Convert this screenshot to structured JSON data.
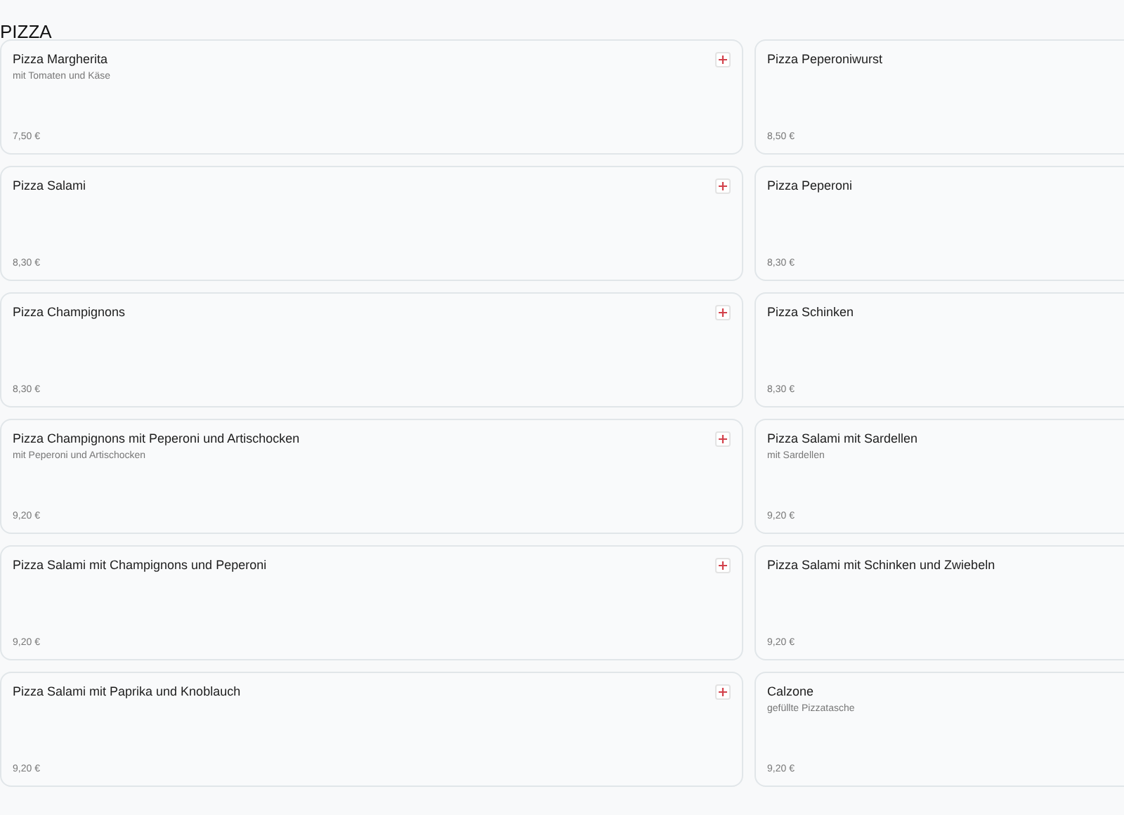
{
  "heading": "PIZZA",
  "items": [
    {
      "name": "Pizza Margherita",
      "description": "mit Tomaten und Käse",
      "price": "7,50 €"
    },
    {
      "name": "Pizza Peperoniwurst",
      "price": "8,50 €"
    },
    {
      "name": "Pizza Salami",
      "price": "8,30 €"
    },
    {
      "name": "Pizza Peperoni",
      "price": "8,30 €"
    },
    {
      "name": "Pizza Champignons",
      "price": "8,30 €"
    },
    {
      "name": "Pizza Schinken",
      "price": "8,30 €"
    },
    {
      "name": "Pizza Champignons mit Peperoni und Artischocken",
      "description": "mit Peperoni und Artischocken",
      "price": "9,20 €"
    },
    {
      "name": "Pizza Salami mit Sardellen",
      "description": "mit Sardellen",
      "price": "9,20 €"
    },
    {
      "name": "Pizza Salami mit Champignons und Peperoni",
      "price": "9,20 €"
    },
    {
      "name": "Pizza Salami mit Schinken und Zwiebeln",
      "price": "9,20 €"
    },
    {
      "name": "Pizza Salami mit Paprika und Knoblauch",
      "price": "9,20 €"
    },
    {
      "name": "Calzone",
      "description": "gefüllte Pizzatasche",
      "price": "9,20 €"
    }
  ]
}
